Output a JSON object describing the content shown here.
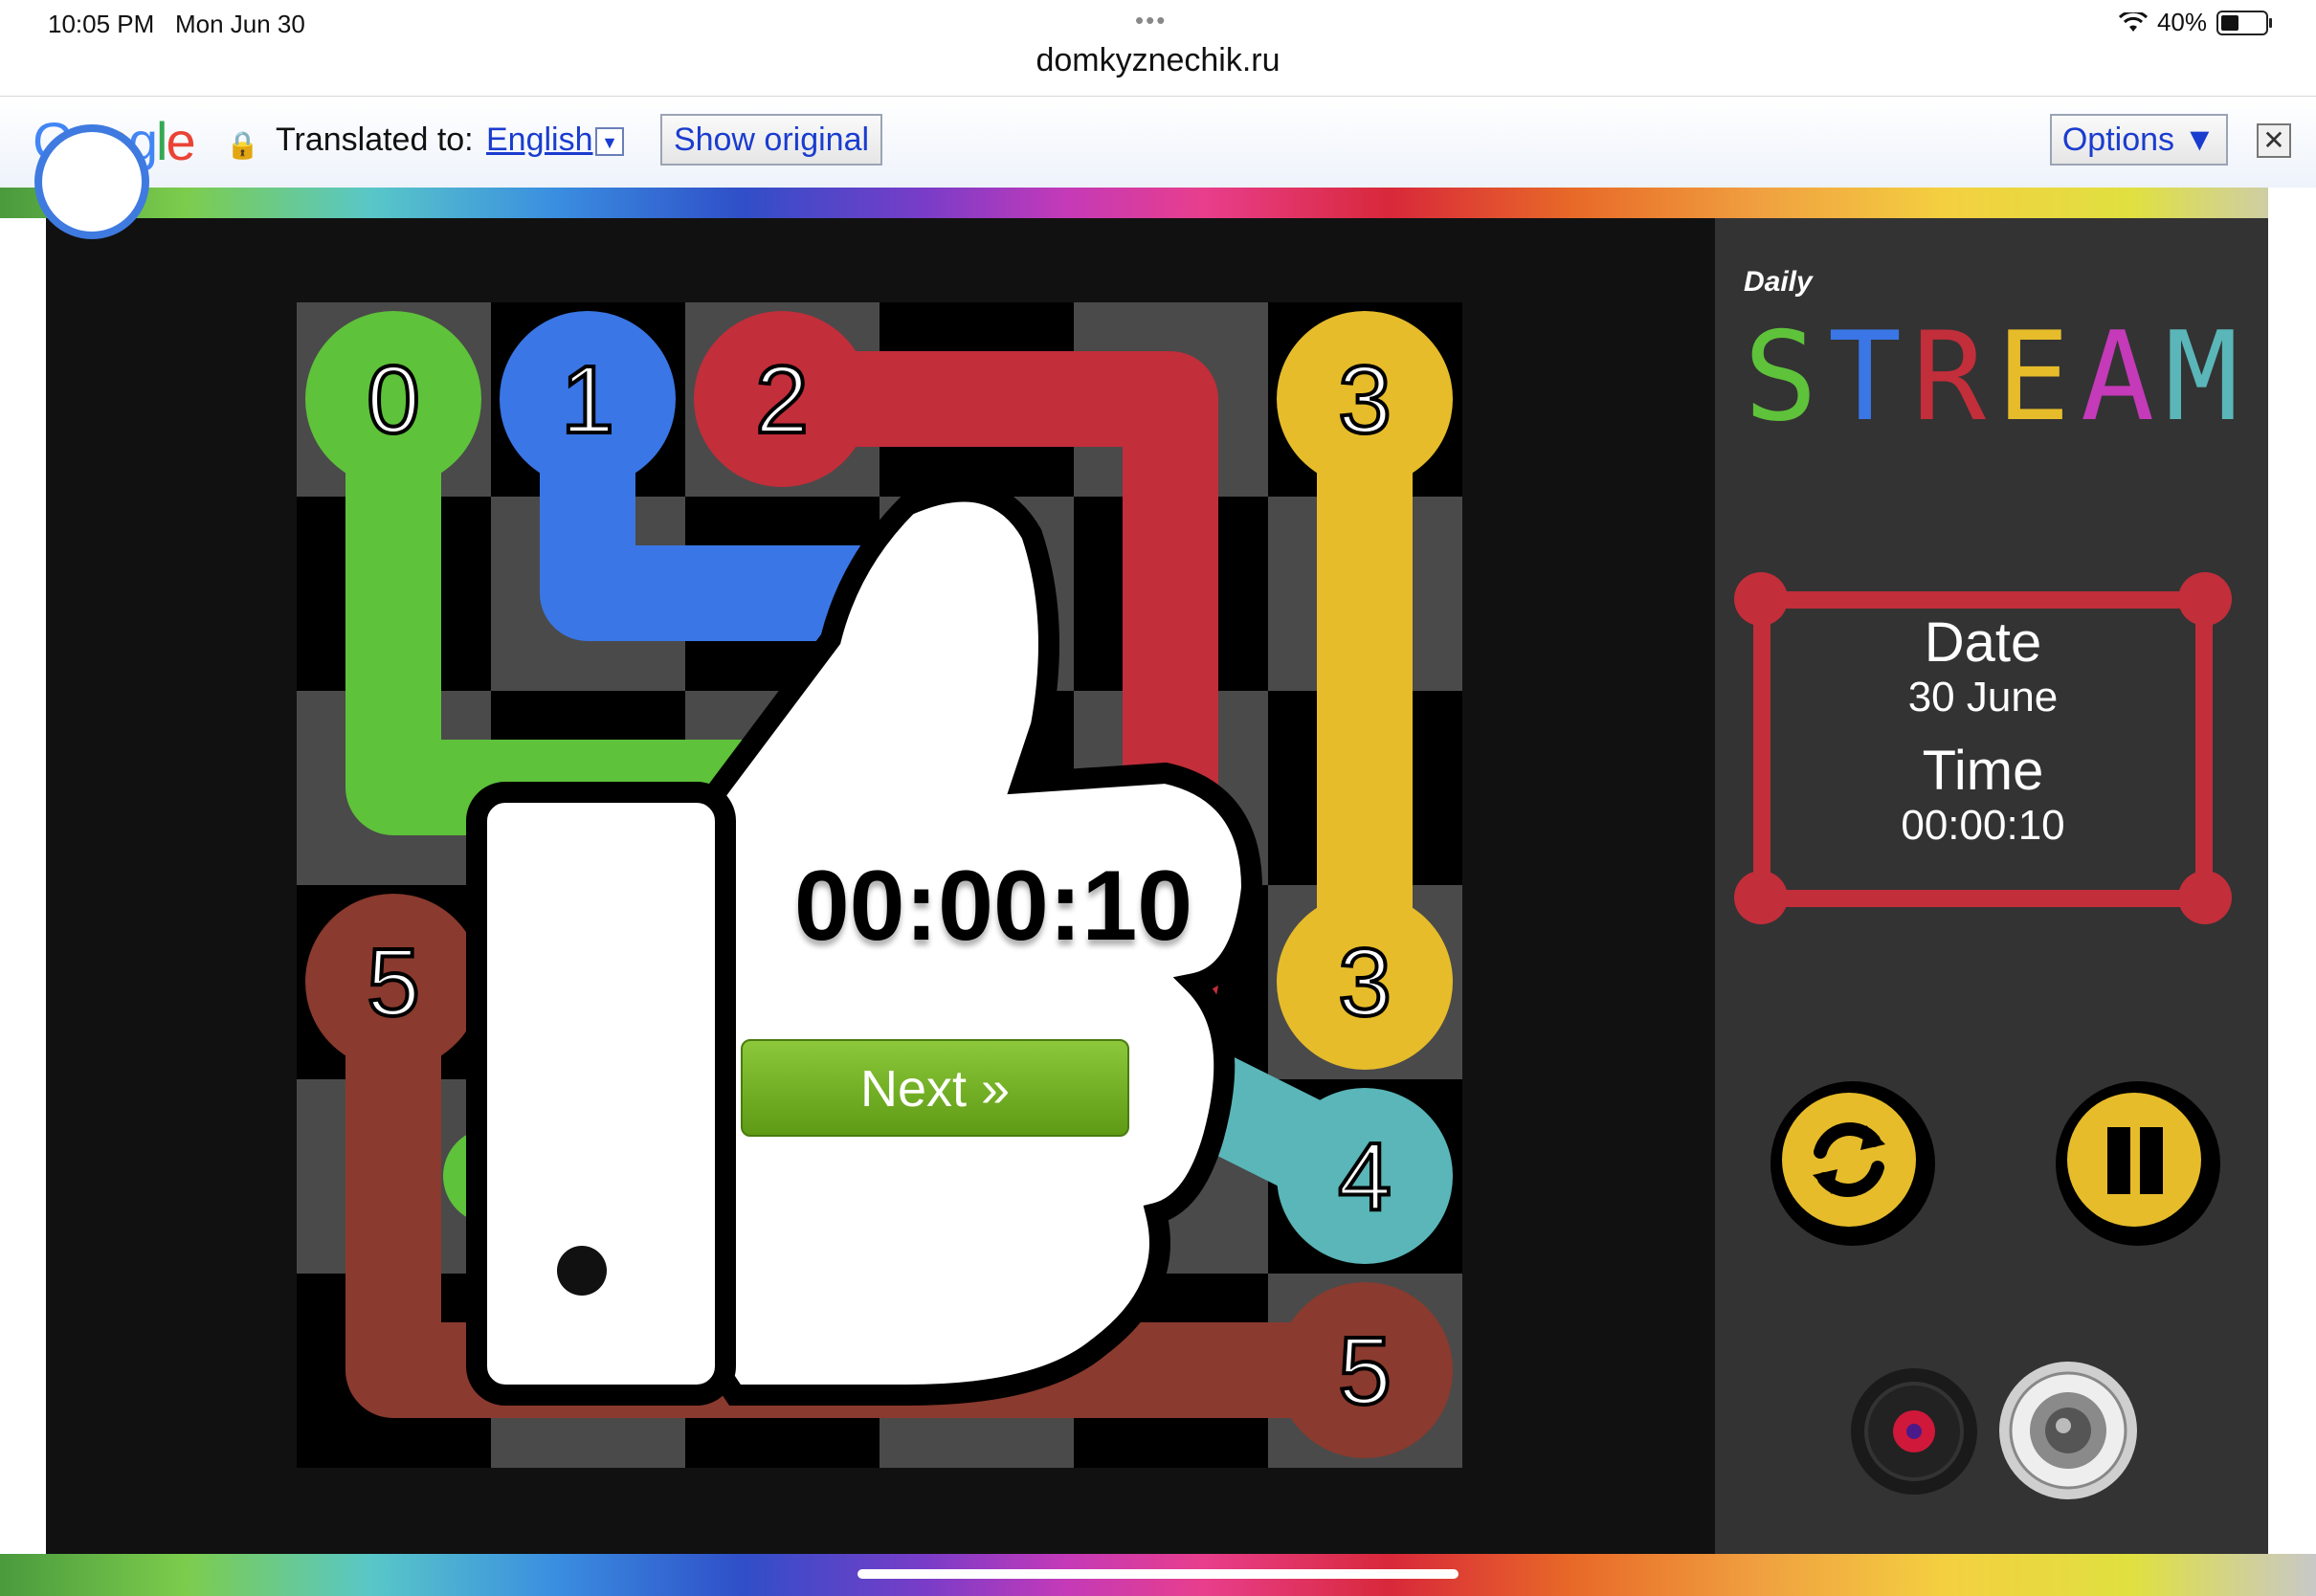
{
  "status_bar": {
    "time": "10:05 PM",
    "date": "Mon Jun 30",
    "battery": "40%",
    "dots": "•••"
  },
  "browser": {
    "url": "domkyznechik.ru"
  },
  "translate_bar": {
    "logo": "Google",
    "translated_to": "Translated to:",
    "language": "English",
    "language_dropdown": "▼",
    "show_original": "Show original",
    "options": "Options ▼",
    "close": "✕"
  },
  "game": {
    "title_small": "Daily",
    "title": "STREAM",
    "grid": {
      "rows": 6,
      "cols": 6
    },
    "paths": [
      {
        "color_id": "green",
        "number": "0",
        "color": "#5ec23a"
      },
      {
        "color_id": "blue",
        "number": "1",
        "color": "#3a76e6"
      },
      {
        "color_id": "red",
        "number": "2",
        "color": "#c22e3a"
      },
      {
        "color_id": "yellow",
        "number": "3",
        "color": "#e6bc2a"
      },
      {
        "color_id": "teal",
        "number": "4",
        "color": "#5ab6b8"
      },
      {
        "color_id": "brown",
        "number": "5",
        "color": "#8a3a2e"
      }
    ],
    "endpoints": [
      {
        "label": "0",
        "color": "green"
      },
      {
        "label": "1",
        "color": "blue"
      },
      {
        "label": "2",
        "color": "red"
      },
      {
        "label": "3",
        "color": "yellow"
      },
      {
        "label": "3",
        "color": "yellow"
      },
      {
        "label": "5",
        "color": "brown"
      },
      {
        "label": "4",
        "color": "teal"
      },
      {
        "label": "5",
        "color": "brown"
      }
    ],
    "overlay": {
      "timer": "00:00:10",
      "next_button": "Next »"
    },
    "info": {
      "date_label": "Date",
      "date_value": "30 June",
      "time_label": "Time",
      "time_value": "00:00:10"
    },
    "controls": [
      "restart-icon",
      "pause-icon",
      "record-icon",
      "speaker-icon"
    ]
  }
}
